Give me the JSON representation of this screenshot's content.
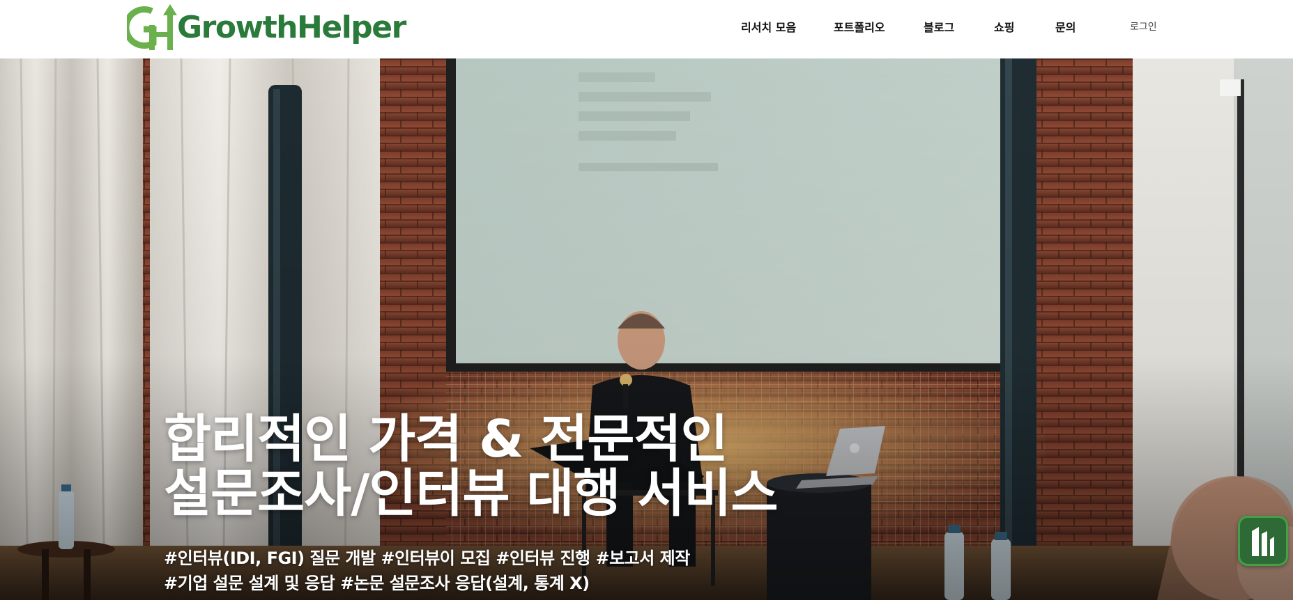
{
  "brand": {
    "name": "GrowthHelper",
    "colors": {
      "dark_green": "#2a7a3a",
      "light_green": "#6ab04c"
    }
  },
  "nav": {
    "items": [
      {
        "label": "리서치 모음"
      },
      {
        "label": "포트폴리오"
      },
      {
        "label": "블로그"
      },
      {
        "label": "쇼핑"
      },
      {
        "label": "문의"
      }
    ],
    "login_label": "로그인"
  },
  "hero": {
    "title_lines": [
      "합리적인 가격 & 전문적인",
      "설문조사/인터뷰 대행 서비스"
    ],
    "tag_lines": [
      "#인터뷰(IDI, FGI) 질문 개발 #인터뷰이 모집 #인터뷰 진행 #보고서 제작",
      "#기업 설문 설계 및 응답 #논문 설문조사 응답(설계, 통계 X)"
    ]
  },
  "floating_button": {
    "icon": "app-badge-icon",
    "color": "#2e6a36"
  }
}
